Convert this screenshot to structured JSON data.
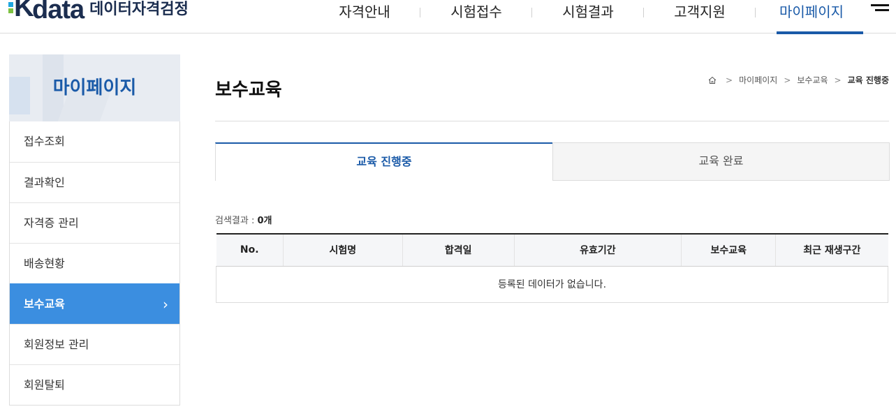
{
  "header": {
    "logo": {
      "mark": "K",
      "word": "data",
      "subtitle": "데이터자격검정"
    },
    "nav": [
      {
        "label": "자격안내",
        "active": false
      },
      {
        "label": "시험접수",
        "active": false
      },
      {
        "label": "시험결과",
        "active": false
      },
      {
        "label": "고객지원",
        "active": false
      },
      {
        "label": "마이페이지",
        "active": true
      }
    ],
    "menu_icon": "hamburger-icon"
  },
  "sidebar": {
    "title": "마이페이지",
    "items": [
      {
        "label": "접수조회",
        "active": false
      },
      {
        "label": "결과확인",
        "active": false
      },
      {
        "label": "자격증 관리",
        "active": false
      },
      {
        "label": "배송현황",
        "active": false
      },
      {
        "label": "보수교육",
        "active": true
      },
      {
        "label": "회원정보 관리",
        "active": false
      },
      {
        "label": "회원탈퇴",
        "active": false
      }
    ]
  },
  "main": {
    "title": "보수교육",
    "breadcrumb": {
      "home_icon": "home-icon",
      "items": [
        "마이페이지",
        "보수교육",
        "교육 진행중"
      ]
    },
    "tabs": [
      {
        "label": "교육 진행중",
        "active": true
      },
      {
        "label": "교육 완료",
        "active": false
      }
    ],
    "result_label": "검색결과 : ",
    "result_count": "0개",
    "table": {
      "columns": [
        "No.",
        "시험명",
        "합격일",
        "유효기간",
        "보수교육",
        "최근 재생구간"
      ],
      "empty_message": "등록된 데이터가 없습니다."
    }
  },
  "colors": {
    "accent": "#1a5aa8",
    "sidebar_active": "#3b8ee0",
    "logo_navy": "#1b2d4f"
  }
}
